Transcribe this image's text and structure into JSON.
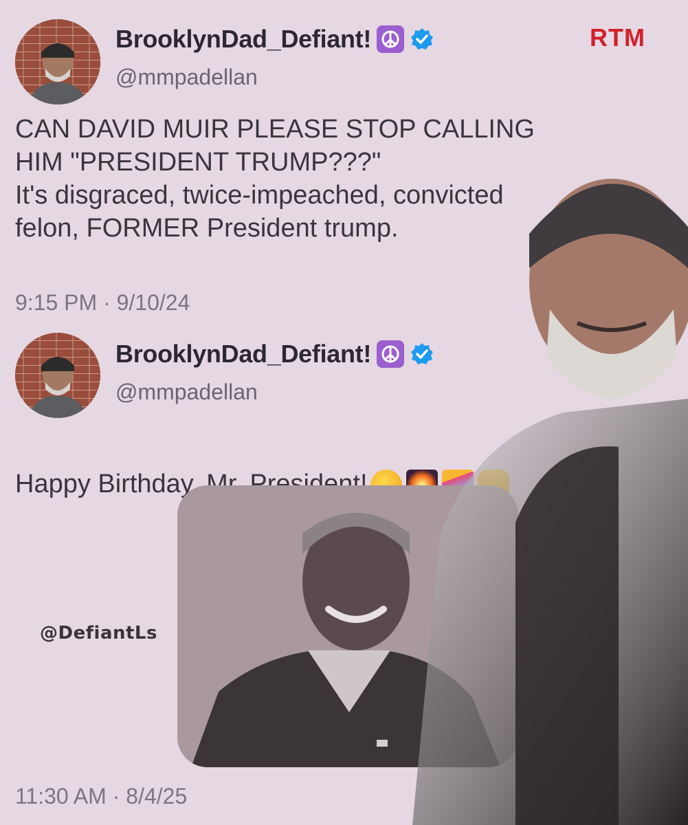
{
  "branding": {
    "logo_text": "RTM",
    "watermark": "@DefiantLs"
  },
  "tweets": [
    {
      "display_name": "BrooklynDad_Defiant!",
      "handle": "@mmpadellan",
      "text": "CAN DAVID MUIR PLEASE STOP CALLING\nHIM \"PRESIDENT TRUMP???\"\nIt's disgraced, twice-impeached, convicted\nfelon, FORMER President trump.",
      "timestamp": "9:15 PM · 9/10/24"
    },
    {
      "display_name": "BrooklynDad_Defiant!",
      "handle": "@mmpadellan",
      "text": "Happy Birthday, Mr. President!",
      "emojis": [
        "partying-face-icon",
        "fireworks-icon",
        "confetti-ball-icon",
        "raised-hands-icon"
      ],
      "timestamp": "11:30 AM · 8/4/25"
    }
  ],
  "colors": {
    "background": "#e5d8e3",
    "logo": "#d3212a",
    "verified": "#1d9bf0",
    "peace": "#9b5fd0"
  }
}
